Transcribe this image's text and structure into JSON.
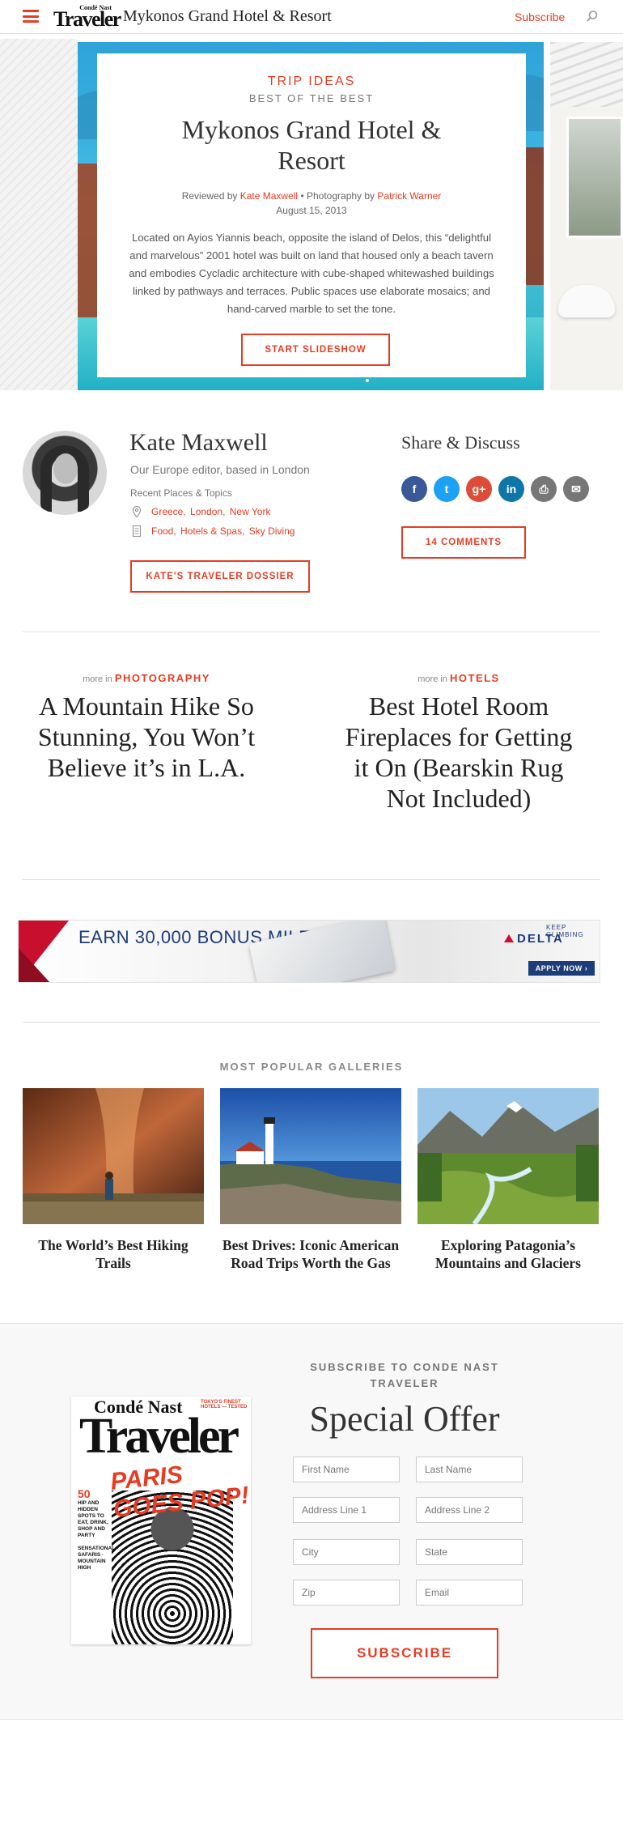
{
  "header": {
    "brand_small": "Condé Nast",
    "brand": "Traveler",
    "title": "Mykonos Grand Hotel & Resort",
    "subscribe": "Subscribe",
    "icons": {
      "menu": "hamburger-icon",
      "search": "search-icon"
    }
  },
  "hero": {
    "category": "TRIP IDEAS",
    "kicker": "BEST OF THE BEST",
    "title": "Mykonos Grand Hotel & Resort",
    "reviewed_by_label": "Reviewed by",
    "reviewer": "Kate Maxwell",
    "photo_label": "• Photography by",
    "photographer": "Patrick Warner",
    "date": "August 15, 2013",
    "description": "Located on Ayios Yiannis beach, opposite the island of Delos, this “delightful and marvelous” 2001 hotel was built on land that housed only a beach tavern and embodies Cycladic architecture with cube-shaped whitewashed buildings linked by pathways and terraces. Public spaces use elaborate mosaics; and hand-carved marble to set the tone.",
    "cta": "START SLIDESHOW"
  },
  "author": {
    "name": "Kate Maxwell",
    "role": "Our Europe editor, based in London",
    "recent_label": "Recent Places & Topics",
    "places": [
      "Greece,",
      "London,",
      "New York"
    ],
    "topics": [
      "Food,",
      "Hotels & Spas,",
      "Sky Diving"
    ],
    "dossier_button": "KATE'S TRAVELER DOSSIER"
  },
  "share": {
    "title": "Share & Discuss",
    "icons": [
      {
        "name": "facebook-icon",
        "glyph": "f",
        "color": "#3b5998"
      },
      {
        "name": "twitter-icon",
        "glyph": "t",
        "color": "#1da1f2"
      },
      {
        "name": "google-plus-icon",
        "glyph": "g+",
        "color": "#dd4b39"
      },
      {
        "name": "linkedin-icon",
        "glyph": "in",
        "color": "#0e76a8"
      },
      {
        "name": "print-icon",
        "glyph": "⎙",
        "color": "#777777"
      },
      {
        "name": "email-icon",
        "glyph": "✉",
        "color": "#777777"
      }
    ],
    "comments_button": "14 COMMENTS"
  },
  "more": [
    {
      "label": "more in",
      "section": "PHOTOGRAPHY",
      "title": "A Mountain Hike So Stunning, You Won’t Believe it’s in L.A."
    },
    {
      "label": "more in",
      "section": "HOTELS",
      "title": "Best Hotel Room Fireplaces for Getting it On (Bearskin Rug Not Included)"
    }
  ],
  "ad": {
    "headline": "EARN 30,000 BONUS MILES.",
    "tagline": "KEEP CLIMBING",
    "brand": "DELTA",
    "cta": "APPLY NOW ›"
  },
  "galleries": {
    "heading": "MOST POPULAR GALLERIES",
    "items": [
      {
        "caption": "The World’s Best Hiking Trails"
      },
      {
        "caption": "Best Drives: Iconic American Road Trips Worth the Gas"
      },
      {
        "caption": "Exploring Patagonia’s Mountains and Glaciers"
      }
    ]
  },
  "subscribe": {
    "kicker": "SUBSCRIBE TO CONDE NAST TRAVELER",
    "title": "Special Offer",
    "magazine": {
      "brand_small": "Condé Nast",
      "brand": "Traveler",
      "headline": "PARIS GOES POP!",
      "tag": "TOKYO'S FINEST HOTELS — TESTED",
      "side_number": "50",
      "side_text": "HIP AND HIDDEN SPOTS TO EAT, DRINK, SHOP AND PARTY",
      "side_more": "SENSATIONAL SAFARIS · MOUNTAIN HIGH"
    },
    "fields": {
      "first_name": "First Name",
      "last_name": "Last Name",
      "address1": "Address Line 1",
      "address2": "Address Line 2",
      "city": "City",
      "state": "State",
      "zip": "Zip",
      "email": "Email"
    },
    "button": "SUBSCRIBE"
  }
}
